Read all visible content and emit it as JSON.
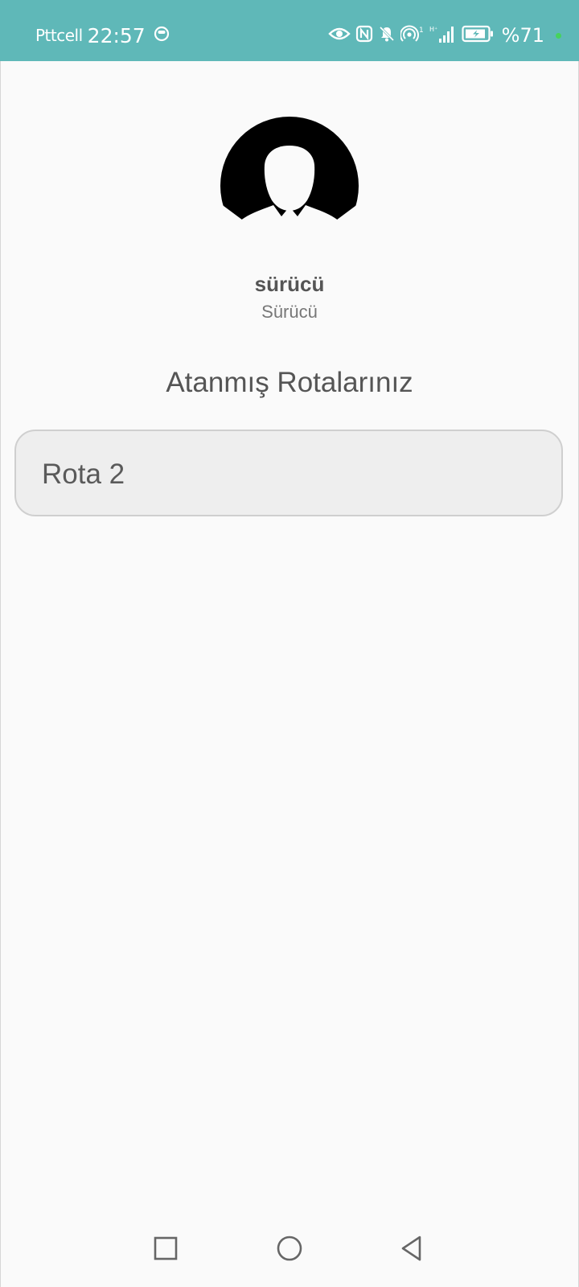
{
  "status_bar": {
    "carrier": "Pttcell",
    "time": "22:57",
    "battery_percent": "%71",
    "background_color": "#5fb8b8",
    "icons": [
      "messenger-icon",
      "eye-icon",
      "nfc-icon",
      "mute-icon",
      "hotspot-icon",
      "signal-icon",
      "battery-charging-icon"
    ]
  },
  "profile": {
    "name": "sürücü",
    "role": "Sürücü",
    "avatar_icon": "user-silhouette-icon"
  },
  "routes": {
    "title": "Atanmış Rotalarınız",
    "items": [
      {
        "label": "Rota 2"
      }
    ]
  },
  "nav_bar": {
    "buttons": [
      "recents-square-icon",
      "home-circle-icon",
      "back-triangle-icon"
    ]
  }
}
